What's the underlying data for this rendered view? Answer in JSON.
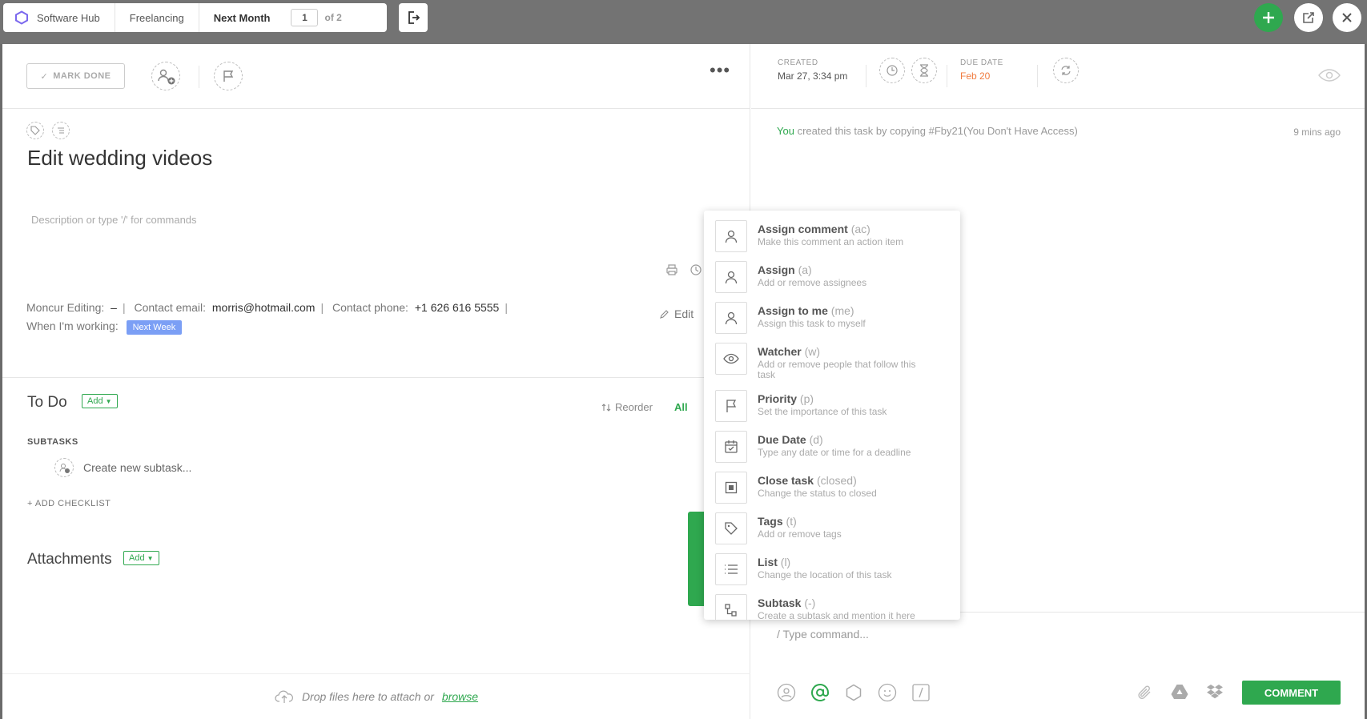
{
  "breadcrumb": {
    "workspace": "Software Hub",
    "folder": "Freelancing",
    "list": "Next Month",
    "page_current": "1",
    "page_of": "of 2"
  },
  "toolbar": {
    "mark_done": "MARK DONE",
    "more": "•••"
  },
  "task": {
    "title": "Edit wedding videos",
    "description_placeholder": "Description or type '/' for commands"
  },
  "fields": {
    "moncur_label": "Moncur Editing:",
    "moncur_value": "–",
    "email_label": "Contact email:",
    "email_value": "morris@hotmail.com",
    "phone_label": "Contact phone:",
    "phone_value": "+1 626 616 5555",
    "working_label": "When I'm working:",
    "working_value": "Next Week",
    "edit": "Edit"
  },
  "todo": {
    "title": "To Do",
    "add": "Add",
    "reorder": "Reorder",
    "all": "All",
    "subtasks_label": "SUBTASKS",
    "new_subtask": "Create new subtask...",
    "add_checklist": "+ ADD CHECKLIST"
  },
  "attachments": {
    "title": "Attachments",
    "add": "Add",
    "drop_text": "Drop files here to attach or",
    "browse": "browse"
  },
  "meta": {
    "created_label": "CREATED",
    "created_value": "Mar 27, 3:34 pm",
    "due_label": "DUE DATE",
    "due_value": "Feb 20",
    "due_color": "#f07b3f"
  },
  "activity": {
    "actor": "You",
    "text": "created this task by copying  #Fby21(You Don't Have Access)",
    "time": "9 mins ago"
  },
  "comment": {
    "input_placeholder": "/ Type command...",
    "button": "COMMENT"
  },
  "command_menu": [
    {
      "name": "Assign comment",
      "key": "(ac)",
      "desc": "Make this comment an action item",
      "icon": "person-icon"
    },
    {
      "name": "Assign",
      "key": "(a)",
      "desc": "Add or remove assignees",
      "icon": "person-icon"
    },
    {
      "name": "Assign to me",
      "key": "(me)",
      "desc": "Assign this task to myself",
      "icon": "person-icon"
    },
    {
      "name": "Watcher",
      "key": "(w)",
      "desc": "Add or remove people that follow this task",
      "icon": "eye-icon"
    },
    {
      "name": "Priority",
      "key": "(p)",
      "desc": "Set the importance of this task",
      "icon": "flag-icon"
    },
    {
      "name": "Due Date",
      "key": "(d)",
      "desc": "Type any date or time for a deadline",
      "icon": "calendar-icon"
    },
    {
      "name": "Close task",
      "key": "(closed)",
      "desc": "Change the status to closed",
      "icon": "square-icon"
    },
    {
      "name": "Tags",
      "key": "(t)",
      "desc": "Add or remove tags",
      "icon": "tag-icon"
    },
    {
      "name": "List",
      "key": "(l)",
      "desc": "Change the location of this task",
      "icon": "list-icon"
    },
    {
      "name": "Subtask",
      "key": "(-)",
      "desc": "Create a subtask and mention it here",
      "icon": "subtask-icon"
    }
  ],
  "colors": {
    "accent": "#2fa84f",
    "tag_pill": "#7b9ff5"
  }
}
